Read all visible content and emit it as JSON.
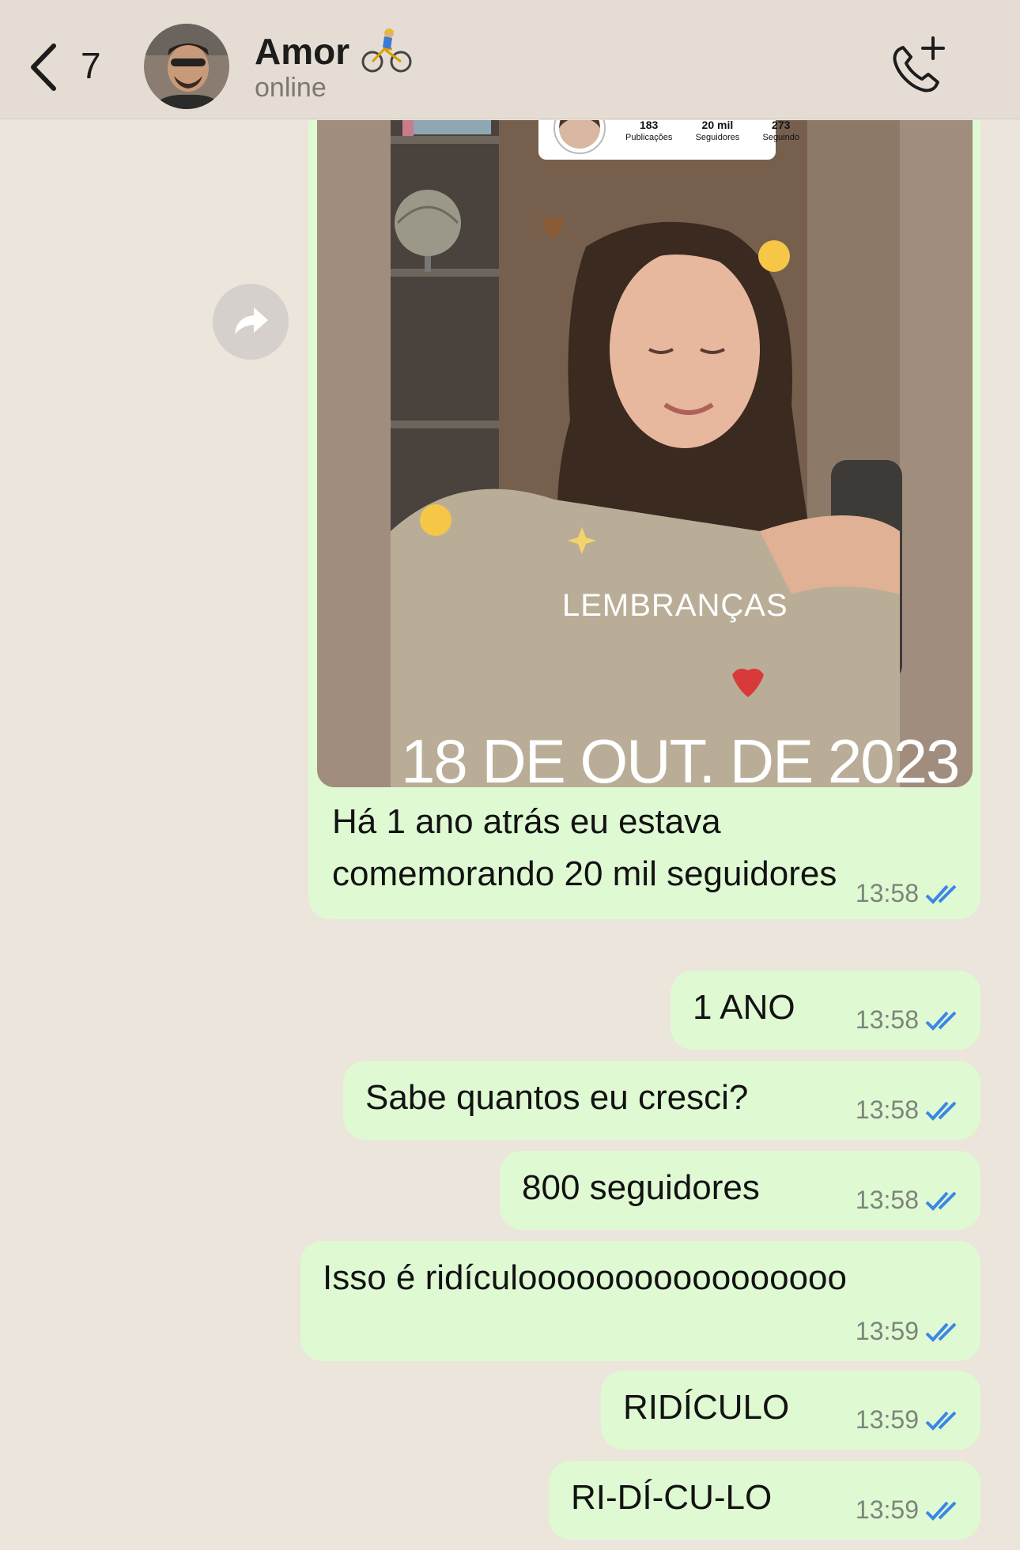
{
  "header": {
    "back_count": "7",
    "contact_name": "Amor",
    "contact_status": "online"
  },
  "image_message": {
    "profile_card": {
      "posts_value": "183",
      "posts_label": "Publicações",
      "followers_value": "20 mil",
      "followers_label": "Seguidores",
      "following_value": "273",
      "following_label": "Seguindo"
    },
    "overlay_title": "LEMBRANÇAS",
    "overlay_date": "18 DE OUT. DE 2023",
    "caption_line1": "Há 1 ano atrás eu estava",
    "caption_line2": "comemorando 20 mil seguidores",
    "time": "13:58"
  },
  "messages": [
    {
      "text": "1 ANO",
      "time": "13:58"
    },
    {
      "text": "Sabe quantos eu cresci?",
      "time": "13:58"
    },
    {
      "text": "800 seguidores",
      "time": "13:58"
    },
    {
      "text": "Isso é ridículooooooooooooooooo",
      "time": "13:59"
    },
    {
      "text": "RIDÍCULO",
      "time": "13:59"
    },
    {
      "text": "RI-DÍ-CU-LO",
      "time": "13:59"
    }
  ],
  "colors": {
    "chat_background": "#ece5dc",
    "outgoing_bubble": "#dff9d3",
    "read_ticks": "#3b86e6"
  }
}
